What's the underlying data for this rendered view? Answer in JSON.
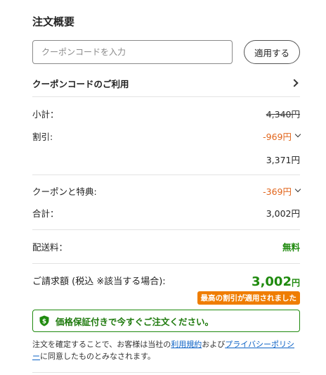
{
  "summary": {
    "title": "注文概要",
    "coupon_placeholder": "クーポンコードを入力",
    "apply_label": "適用する",
    "coupon_use_label": "クーポンコードのご利用",
    "subtotal_label": "小計：",
    "subtotal_value": "4,340円",
    "discount_label": "割引:",
    "discount_value": "-969円",
    "after_discount_value": "3,371円",
    "coupon_benefit_label": "クーポンと特典:",
    "coupon_benefit_value": "-369円",
    "total_label": "合計：",
    "total_value": "3,002円",
    "shipping_label": "配送料：",
    "shipping_value": "無料",
    "billing_label": "ご請求額 (税込 ※該当する場合):",
    "billing_amount": "3,002",
    "billing_currency": "円",
    "best_discount_badge": "最高の割引が適用されました",
    "guarantee_text": "価格保証付きで今すぐご注文ください。",
    "terms_prefix": "注文を確定することで、お客様は当社の",
    "terms_link": "利用規約",
    "terms_middle": "および",
    "privacy_link": "プライバシーポリシー",
    "terms_suffix": "に同意したものとみなされます。"
  },
  "colors": {
    "accent_orange": "#e2651b",
    "badge_orange": "#ef7d00",
    "success_green": "#1f8a0e",
    "link_blue": "#0e63c6"
  },
  "icons": {
    "coupon_use": "chevron-right-icon",
    "expand": "chevron-down-icon",
    "guarantee": "shield-dollar-icon"
  }
}
